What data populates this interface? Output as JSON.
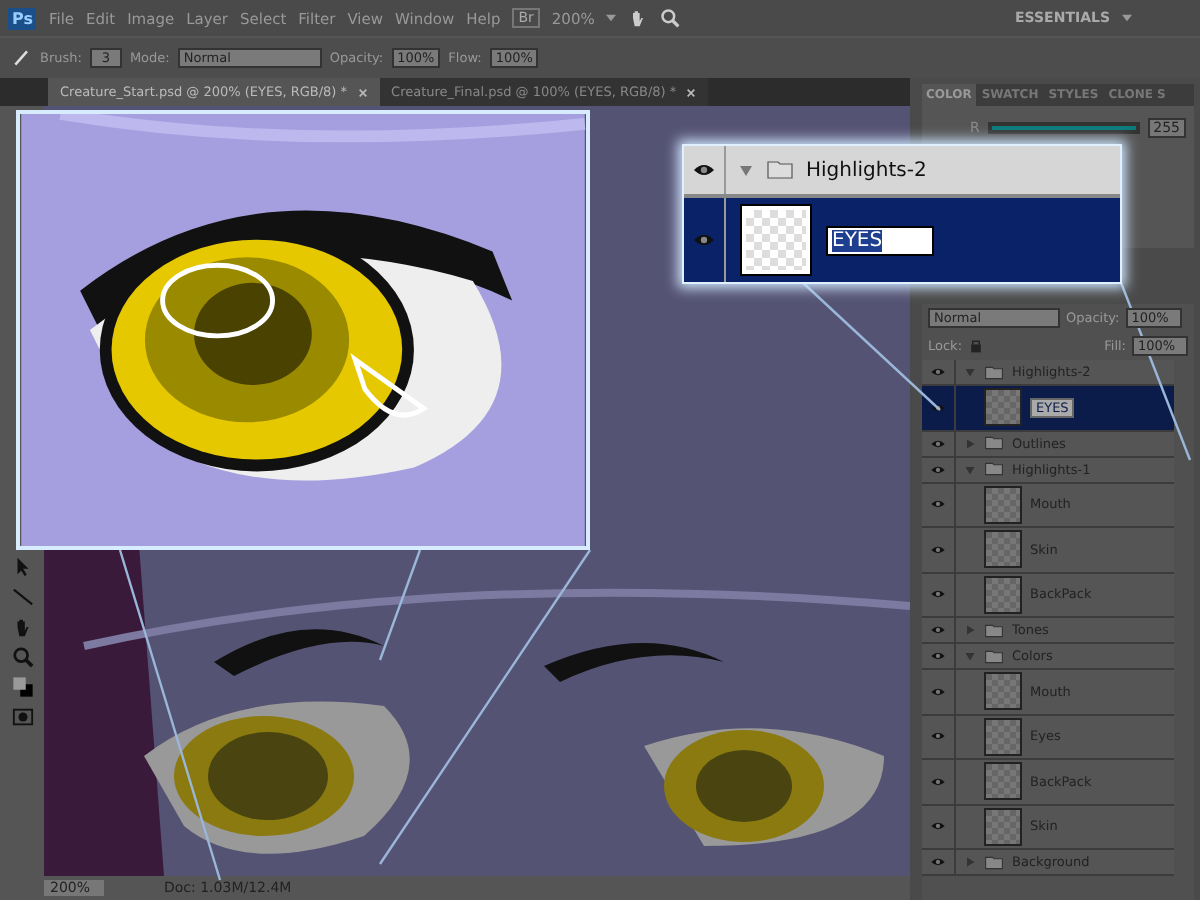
{
  "menu": {
    "logo": "Ps",
    "items": [
      "File",
      "Edit",
      "Image",
      "Layer",
      "Select",
      "Filter",
      "View",
      "Window",
      "Help"
    ],
    "bridge": "Br",
    "zoom": "200%",
    "workspace": "ESSENTIALS"
  },
  "options": {
    "brush_label": "Brush:",
    "brush_size": "3",
    "mode_label": "Mode:",
    "mode": "Normal",
    "opacity_label": "Opacity:",
    "opacity": "100%",
    "flow_label": "Flow:",
    "flow": "100%"
  },
  "documents": [
    {
      "title": "Creature_Start.psd @ 200% (EYES, RGB/8) *",
      "selected": true
    },
    {
      "title": "Creature_Final.psd @ 100% (EYES, RGB/8) *",
      "selected": false
    }
  ],
  "status_bar": {
    "zoom": "200%",
    "doc": "Doc: 1.03M/12.4M"
  },
  "color_panel": {
    "tabs": [
      {
        "label": "COLOR",
        "selected": true
      },
      {
        "label": "SWATCH",
        "selected": false
      },
      {
        "label": "STYLES",
        "selected": false
      },
      {
        "label": "CLONE S",
        "selected": false
      }
    ],
    "channel": "R",
    "level": 1,
    "value": "255"
  },
  "layers_panel": {
    "blend_mode": "Normal",
    "opacity_label": "Opacity:",
    "opacity": "100%",
    "lock_label": "Lock:",
    "fill_label": "Fill:",
    "fill": "100%",
    "layers": [
      {
        "kind": "group",
        "name": "Highlights-2",
        "visible": true,
        "expanded": true,
        "selected": false,
        "children": [
          {
            "kind": "layer",
            "name": "EYES",
            "visible": true,
            "selected": true
          }
        ]
      },
      {
        "kind": "group",
        "name": "Outlines",
        "visible": true,
        "expanded": false,
        "selected": false
      },
      {
        "kind": "group",
        "name": "Highlights-1",
        "visible": true,
        "expanded": true,
        "selected": false,
        "children": [
          {
            "kind": "layer",
            "name": "Mouth",
            "visible": true,
            "selected": false
          },
          {
            "kind": "layer",
            "name": "Skin",
            "visible": true,
            "selected": false
          },
          {
            "kind": "layer",
            "name": "BackPack",
            "visible": true,
            "selected": false
          }
        ]
      },
      {
        "kind": "group",
        "name": "Tones",
        "visible": true,
        "expanded": false,
        "selected": false
      },
      {
        "kind": "group",
        "name": "Colors",
        "visible": true,
        "expanded": true,
        "selected": false,
        "children": [
          {
            "kind": "layer",
            "name": "Mouth",
            "visible": true,
            "selected": false
          },
          {
            "kind": "layer",
            "name": "Eyes",
            "visible": true,
            "selected": false
          },
          {
            "kind": "layer",
            "name": "BackPack",
            "visible": true,
            "selected": false
          },
          {
            "kind": "layer",
            "name": "Skin",
            "visible": true,
            "selected": false
          }
        ]
      },
      {
        "kind": "group",
        "name": "Background",
        "visible": true,
        "expanded": false,
        "selected": false
      }
    ]
  },
  "callout": {
    "group": {
      "name": "Highlights-2",
      "visible": true,
      "expanded": true
    },
    "layer": {
      "name": "EYES",
      "visible": true
    }
  }
}
